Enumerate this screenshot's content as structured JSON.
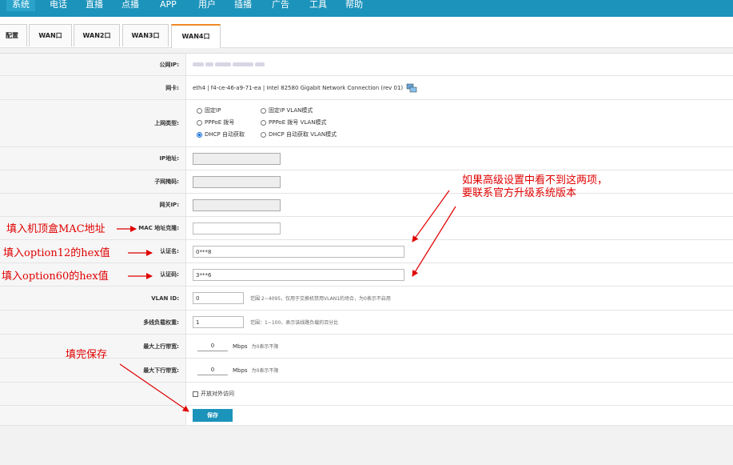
{
  "topnav": {
    "items": [
      {
        "label": "系统"
      },
      {
        "label": "电话"
      },
      {
        "label": "直播"
      },
      {
        "label": "点播"
      },
      {
        "label": "APP"
      },
      {
        "label": "用户"
      },
      {
        "label": "插播"
      },
      {
        "label": "广告"
      },
      {
        "label": "工具"
      },
      {
        "label": "帮助"
      }
    ]
  },
  "tabs": [
    {
      "label": "配置"
    },
    {
      "label": "WAN口"
    },
    {
      "label": "WAN2口"
    },
    {
      "label": "WAN3口"
    },
    {
      "label": "WAN4口",
      "active": true
    }
  ],
  "form": {
    "public_ip": {
      "label": "公网IP:"
    },
    "nic": {
      "label": "网卡:",
      "value": "eth4 | f4-ce-46-a9-71-ea | Intel 82580 Gigabit Network Connection (rev 01)"
    },
    "conn_type": {
      "label": "上网类型:",
      "options": [
        "固定IP",
        "固定IP VLAN模式",
        "PPPoE 拨号",
        "PPPoE 拨号 VLAN模式",
        "DHCP 自动获取",
        "DHCP 自动获取 VLAN模式"
      ],
      "selected": "DHCP 自动获取"
    },
    "ip": {
      "label": "IP地址:"
    },
    "mask": {
      "label": "子网掩码:"
    },
    "gateway": {
      "label": "网关IP:"
    },
    "mac_clone": {
      "label": "MAC 地址克隆:"
    },
    "auth_name": {
      "label": "认证名:",
      "value": "0***8"
    },
    "auth_code": {
      "label": "认证码:",
      "value": "3***6"
    },
    "vlan": {
      "label": "VLAN ID:",
      "value": "0",
      "hint": "范围 2~4095，仅用于交换机禁用VLAN1的场合，为0表示不启用"
    },
    "weight": {
      "label": "多线负载权重:",
      "value": "1",
      "hint": "范围：1~100，表示该线路负载的百分比"
    },
    "up_bw": {
      "label": "最大上行带宽:",
      "value": "0",
      "unit": "Mbps",
      "hint": "为0表示不限"
    },
    "down_bw": {
      "label": "最大下行带宽:",
      "value": "0",
      "unit": "Mbps",
      "hint": "为0表示不限"
    },
    "external_access": {
      "label": "开放对外访问",
      "checked": false
    },
    "save": {
      "label": "保存"
    }
  },
  "annotations": {
    "mac": "填入机顶盒MAC地址",
    "opt12": "填入option12的hex值",
    "opt60": "填入option60的hex值",
    "save": "填完保存",
    "advanced_line1": "如果高级设置中看不到这两项，",
    "advanced_line2": "要联系官方升级系统版本"
  },
  "colors": {
    "nav": "#1c93bb",
    "tab_accent": "#f08a24",
    "annotation": "#e00000",
    "save_button": "#1c93bb"
  }
}
